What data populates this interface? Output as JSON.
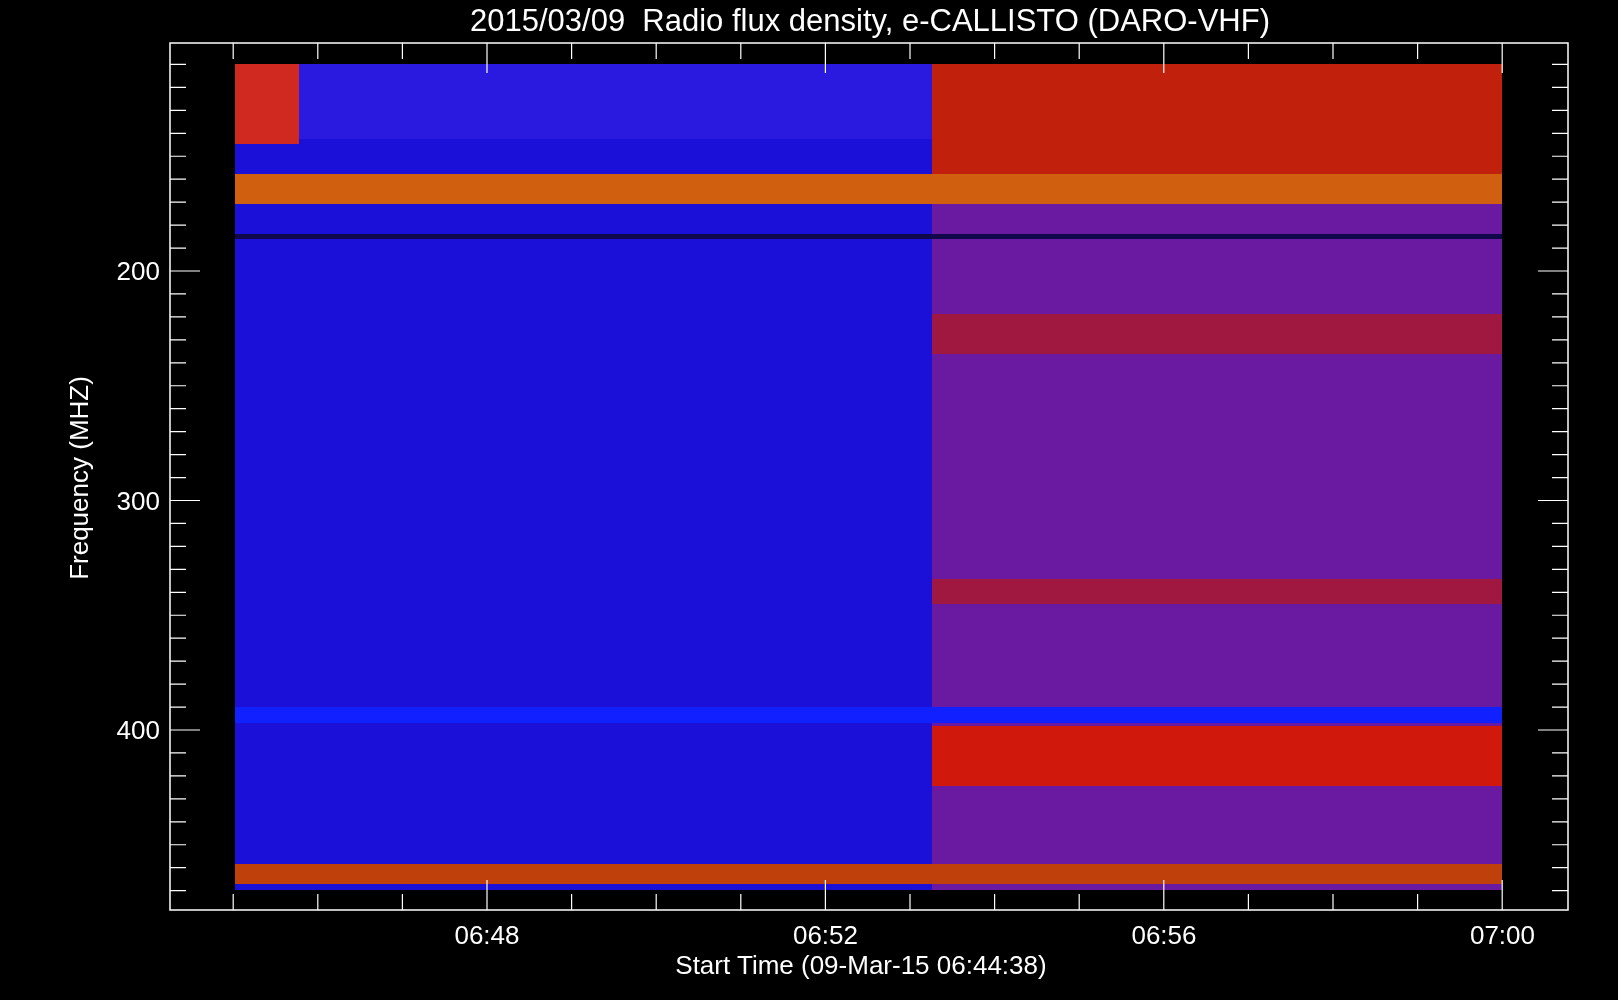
{
  "plot": {
    "title": "2015/03/09  Radio flux density, e-CALLISTO (DARO-VHF)",
    "ylabel": "Frequency (MHZ)",
    "xlabel": "Start Time (09-Mar-15 06:44:38)",
    "yticks": [
      "200",
      "300",
      "400"
    ],
    "xticks": [
      "06:48",
      "06:52",
      "06:56",
      "07:00"
    ]
  }
}
